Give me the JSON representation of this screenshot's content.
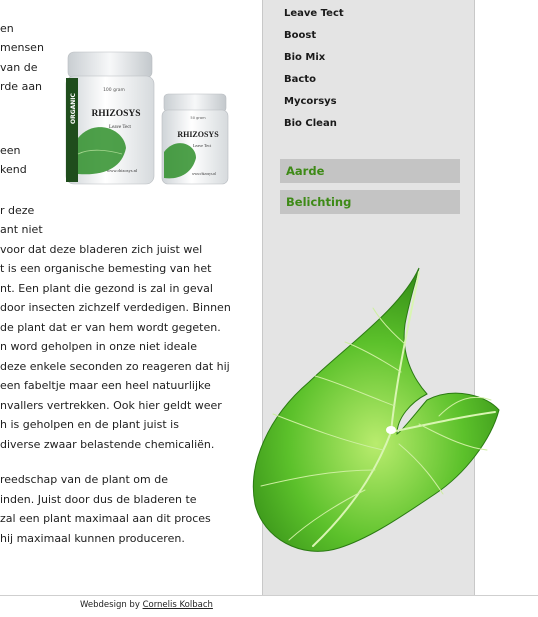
{
  "article": {
    "paragraph1": [
      "en",
      "mensen",
      "van de",
      "rde aan"
    ],
    "paragraph2": [
      "een",
      "kend"
    ],
    "paragraph3": [
      "r deze",
      "ant niet",
      "voor dat deze bladeren zich juist wel",
      "t is een organische bemesting van het",
      "nt. Een plant die gezond is zal in geval",
      "door insecten zichzelf verdedigen. Binnen",
      "de plant dat er van hem wordt gegeten.",
      "n word geholpen in onze niet ideale",
      "deze enkele seconden zo reageren dat hij",
      "een fabeltje maar een heel natuurlijke",
      "nvallers vertrekken. Ook hier geldt weer",
      "h is geholpen en de plant juist is",
      "diverse zwaar belastende chemicaliën."
    ],
    "paragraph4": [
      "reedschap van de plant om de",
      "inden. Juist door dus de bladeren te",
      "zal een plant maximaal aan dit proces",
      "hij maximaal kunnen produceren."
    ]
  },
  "product": {
    "brand": "RHIZOSYS",
    "side_text": "ORGANIC",
    "large_variant": "Leave Tect",
    "small_variant": "Leave Tect",
    "large_size": "100 gram",
    "small_size": "50 gram",
    "url_text": "www.rhizosys.nl"
  },
  "sidebar": {
    "products": [
      "Leave Tect",
      "Boost",
      "Bio Mix",
      "Bacto",
      "Mycorsys",
      "Bio Clean"
    ],
    "categories": [
      "Aarde",
      "Belichting"
    ]
  },
  "footer": {
    "prefix": "Webdesign by",
    "author": "Cornelis Kolbach"
  },
  "colors": {
    "accent_green": "#3e8a17",
    "sidebar_bg": "#e4e4e4",
    "category_bg": "#c4c4c4"
  }
}
